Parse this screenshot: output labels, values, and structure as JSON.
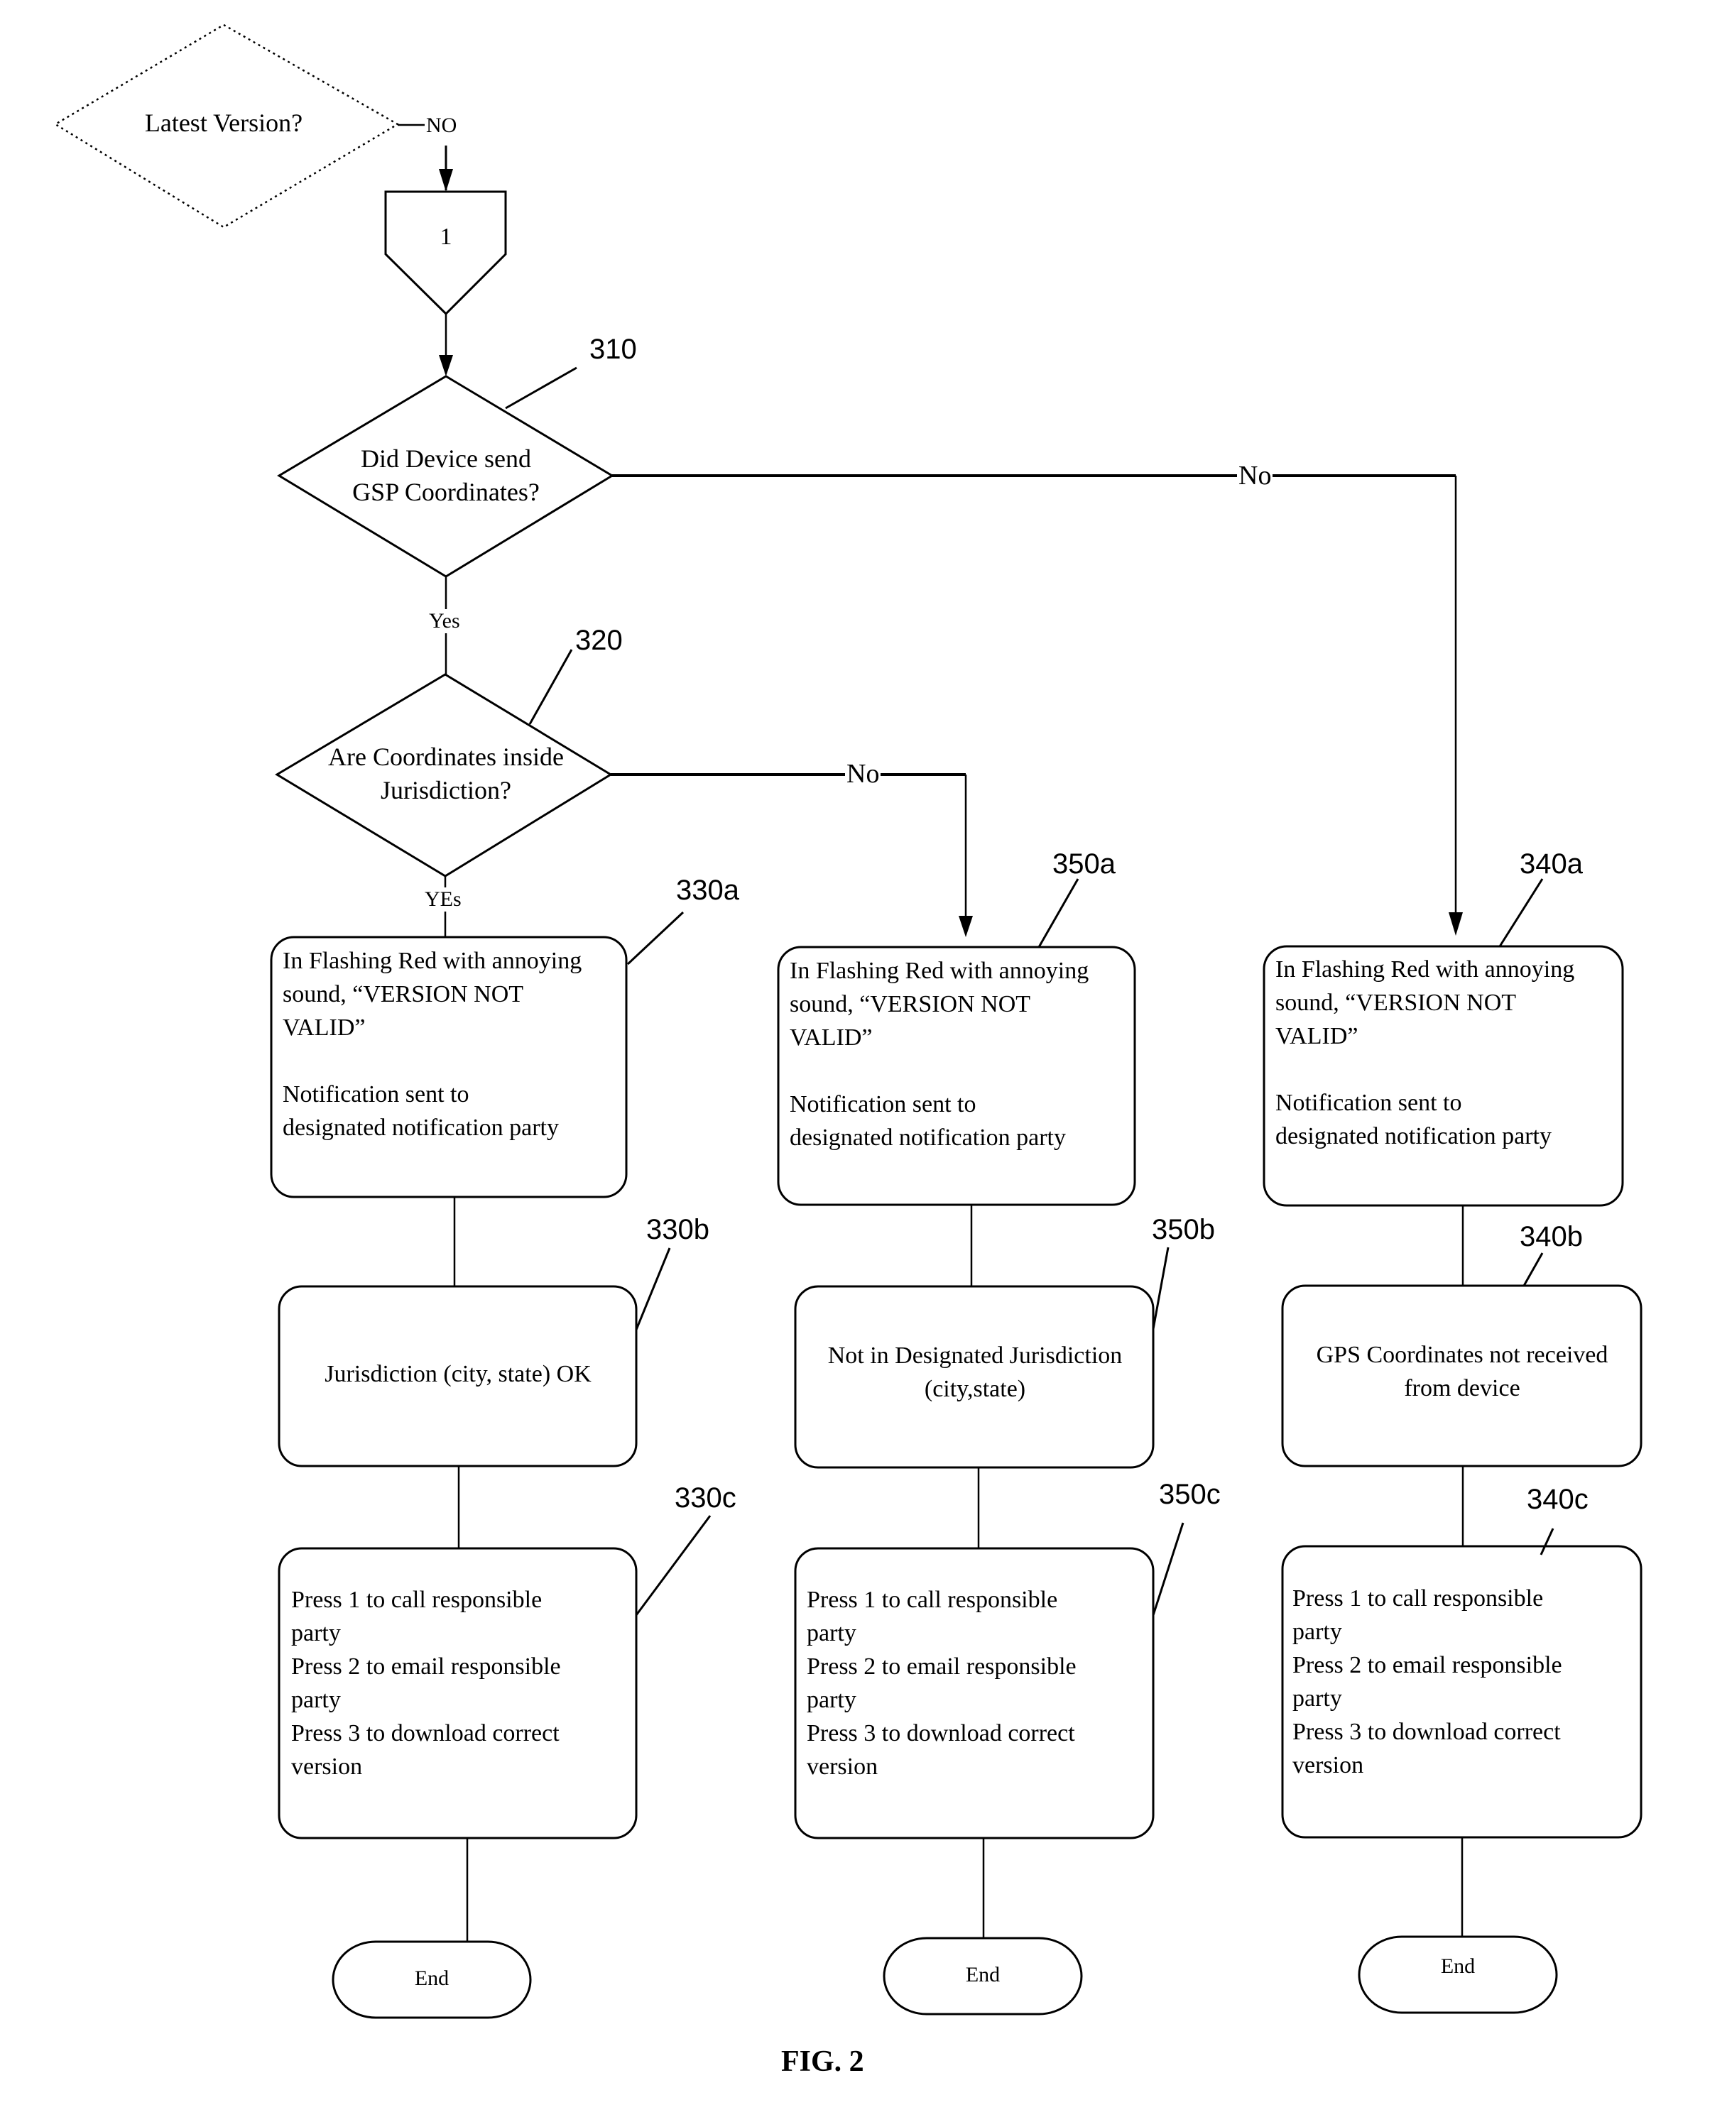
{
  "figure": {
    "caption": "FIG. 2"
  },
  "start_decision": {
    "text": "Latest Version?",
    "no_label": "NO"
  },
  "connector": {
    "label": "1"
  },
  "decision_310": {
    "ref": "310",
    "text": "Did Device send\nGSP Coordinates?",
    "yes_label": "Yes",
    "no_label": "No"
  },
  "decision_320": {
    "ref": "320",
    "text": "Are Coordinates inside\nJurisdiction?",
    "yes_label": "YEs",
    "no_label": "No"
  },
  "branch_330": {
    "a": {
      "ref": "330a",
      "text": "In Flashing Red with annoying\nsound, “VERSION NOT\nVALID”\n\nNotification sent  to\ndesignated notification party"
    },
    "b": {
      "ref": "330b",
      "text": "Jurisdiction (city, state) OK"
    },
    "c": {
      "ref": "330c",
      "text": "Press 1 to call responsible\nparty\nPress 2 to email responsible\nparty\nPress 3 to download correct\nversion"
    },
    "end": "End"
  },
  "branch_350": {
    "a": {
      "ref": "350a",
      "text": "In Flashing Red with annoying\nsound, “VERSION NOT\nVALID”\n\nNotification sent  to\ndesignated notification party"
    },
    "b": {
      "ref": "350b",
      "text": "Not in Designated Jurisdiction\n(city,state)"
    },
    "c": {
      "ref": "350c",
      "text": "Press 1 to call responsible\nparty\nPress 2 to email responsible\nparty\nPress 3 to download correct\nversion"
    },
    "end": "End"
  },
  "branch_340": {
    "a": {
      "ref": "340a",
      "text": "In Flashing Red with annoying\nsound, “VERSION NOT\nVALID”\n\nNotification sent  to\ndesignated notification party"
    },
    "b": {
      "ref": "340b",
      "text": "GPS Coordinates not received\nfrom device"
    },
    "c": {
      "ref": "340c",
      "text": "Press 1 to call responsible\nparty\nPress 2 to email responsible\nparty\nPress 3 to download correct\nversion"
    },
    "end": "End"
  }
}
